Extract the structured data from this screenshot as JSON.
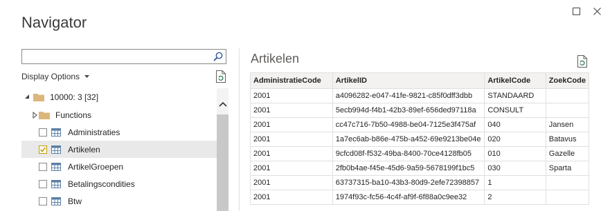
{
  "window": {
    "title": "Navigator"
  },
  "search": {
    "value": "",
    "placeholder": ""
  },
  "display_options": {
    "label": "Display Options"
  },
  "tree": {
    "root": {
      "label": "10000: 3 [32]"
    },
    "items": [
      {
        "label": "Functions",
        "type": "folder"
      },
      {
        "label": "Administraties",
        "type": "table",
        "checked": false
      },
      {
        "label": "Artikelen",
        "type": "table",
        "checked": true
      },
      {
        "label": "ArtikelGroepen",
        "type": "table",
        "checked": false
      },
      {
        "label": "Betalingscondities",
        "type": "table",
        "checked": false
      },
      {
        "label": "Btw",
        "type": "table",
        "checked": false
      }
    ]
  },
  "preview": {
    "title": "Artikelen",
    "columns": [
      "AdministratieCode",
      "ArtikelID",
      "ArtikelCode",
      "ZoekCode"
    ],
    "rows": [
      [
        "2001",
        "a4096282-e047-41fe-9821-c85f0dff3dbb",
        "STANDAARD",
        ""
      ],
      [
        "2001",
        "5ecb994d-f4b1-42b3-89ef-656ded97118a",
        "CONSULT",
        ""
      ],
      [
        "2001",
        "cc47c716-7b50-4988-be04-7125e3f475af",
        "040",
        "Jansen"
      ],
      [
        "2001",
        "1a7ec6ab-b86e-475b-a452-69e9213be04e",
        "020",
        "Batavus"
      ],
      [
        "2001",
        "9cfcd08f-f532-49ba-8400-70ce4128fb05",
        "010",
        "Gazelle"
      ],
      [
        "2001",
        "2fb0b4ae-f45e-45d6-9a59-5678199f1bc5",
        "030",
        "Sparta"
      ],
      [
        "2001",
        "63737315-ba10-43b3-80d9-2efe72398857",
        "1",
        ""
      ],
      [
        "2001",
        "1974f93c-fc56-4c4f-af9f-6f88a0c9ee32",
        "2",
        ""
      ]
    ]
  },
  "colors": {
    "folder": "#dcb67a",
    "check": "#c19c00",
    "table_icon": "#5b7fa6"
  }
}
